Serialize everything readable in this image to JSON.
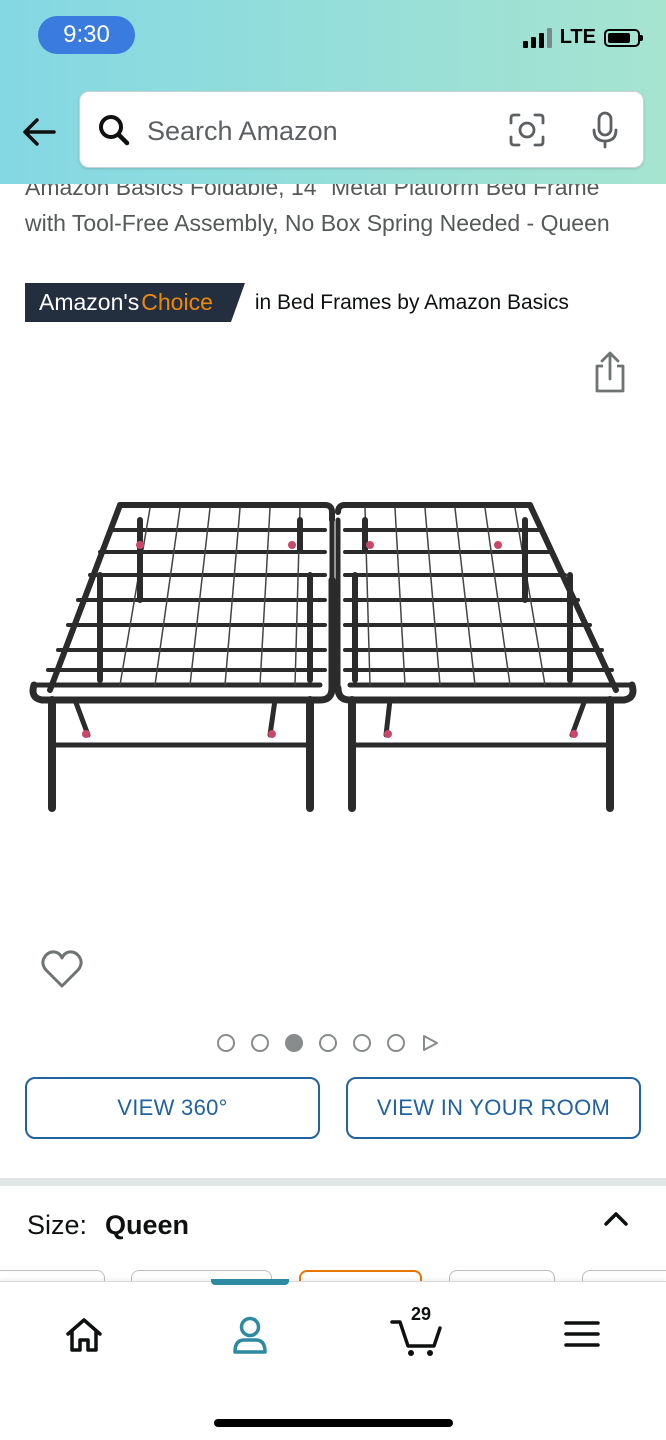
{
  "status_bar": {
    "time": "9:30",
    "network": "LTE"
  },
  "search": {
    "placeholder": "Search Amazon"
  },
  "product": {
    "title": "Amazon Basics Foldable, 14\" Metal Platform Bed Frame with Tool-Free Assembly, No Box Spring Needed - Queen",
    "badge_prefix": "Amazon's",
    "badge_choice": "Choice",
    "badge_category": "in Bed Frames by Amazon Basics"
  },
  "gallery": {
    "image_count": 6,
    "active_index": 2,
    "has_video": true
  },
  "actions": {
    "view_360": "VIEW 360°",
    "view_in_room": "VIEW IN YOUR ROOM"
  },
  "size": {
    "label": "Size:",
    "value": "Queen"
  },
  "nav": {
    "cart_count": "29"
  },
  "icons": [
    "back-arrow-icon",
    "search-icon",
    "camera-lens-icon",
    "microphone-icon",
    "share-icon",
    "heart-icon",
    "home-icon",
    "account-icon",
    "cart-icon",
    "menu-icon"
  ],
  "colors": {
    "badge_bg": "#232f3e",
    "badge_choice": "#f08804",
    "link_blue": "#2162a1",
    "nav_accent": "#2e8aa0",
    "selected_swatch": "#e77600"
  }
}
